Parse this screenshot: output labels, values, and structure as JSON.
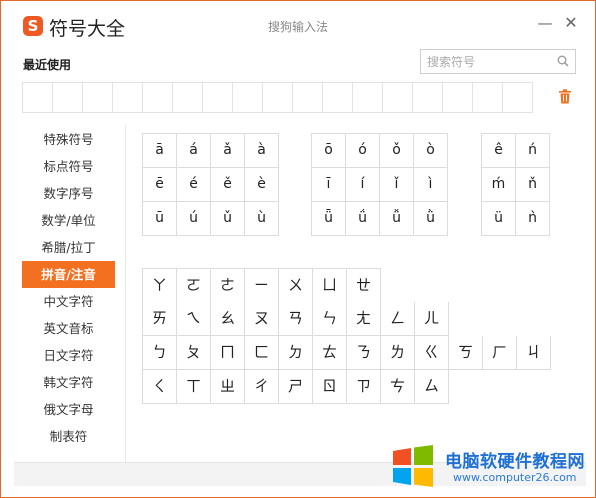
{
  "titlebar": {
    "logo_letter": "S",
    "app_title": "符号大全",
    "center_title": "搜狗输入法",
    "minimize_glyph": "—",
    "close_glyph": "✕"
  },
  "recent": {
    "label": "最近使用",
    "cell_count": 17
  },
  "search": {
    "placeholder": "搜索符号"
  },
  "sidebar": {
    "items": [
      {
        "label": "特殊符号"
      },
      {
        "label": "标点符号"
      },
      {
        "label": "数字序号"
      },
      {
        "label": "数学/单位"
      },
      {
        "label": "希腊/拉丁"
      },
      {
        "label": "拼音/注音",
        "active": true
      },
      {
        "label": "中文字符"
      },
      {
        "label": "英文音标"
      },
      {
        "label": "日文字符"
      },
      {
        "label": "韩文字符"
      },
      {
        "label": "俄文字母"
      },
      {
        "label": "制表符"
      }
    ]
  },
  "pinyin": {
    "group1": [
      "ā",
      "á",
      "ǎ",
      "à",
      "ē",
      "é",
      "ě",
      "è",
      "ū",
      "ú",
      "ǔ",
      "ù"
    ],
    "group2": [
      "ō",
      "ó",
      "ǒ",
      "ò",
      "ī",
      "í",
      "ǐ",
      "ì",
      "ǖ",
      "ǘ",
      "ǚ",
      "ǜ"
    ],
    "group3": [
      "ê",
      "ń",
      "ḿ",
      "ň",
      "ü",
      "ǹ"
    ]
  },
  "bopomofo": {
    "rows": [
      [
        "ㄚ",
        "ㄛ",
        "ㄜ",
        "ㄧ",
        "ㄨ",
        "ㄩ",
        "ㄝ"
      ],
      [
        "ㄞ",
        "ㄟ",
        "ㄠ",
        "ㄡ",
        "ㄢ",
        "ㄣ",
        "ㄤ",
        "ㄥ",
        "ㄦ"
      ],
      [
        "ㄅ",
        "ㄆ",
        "ㄇ",
        "ㄈ",
        "ㄉ",
        "ㄊ",
        "ㄋ",
        "ㄌ",
        "ㄍ",
        "ㄎ",
        "ㄏ",
        "ㄐ"
      ],
      [
        "ㄑ",
        "ㄒ",
        "ㄓ",
        "ㄔ",
        "ㄕ",
        "ㄖ",
        "ㄗ",
        "ㄘ",
        "ㄙ"
      ]
    ]
  },
  "watermark": {
    "title": "电脑软硬件教程网",
    "url": "www.computer26.com",
    "colors": [
      "#f25022",
      "#7fba00",
      "#00a4ef",
      "#ffb900"
    ]
  },
  "colors": {
    "accent": "#f37021",
    "border": "#e06a2a"
  }
}
